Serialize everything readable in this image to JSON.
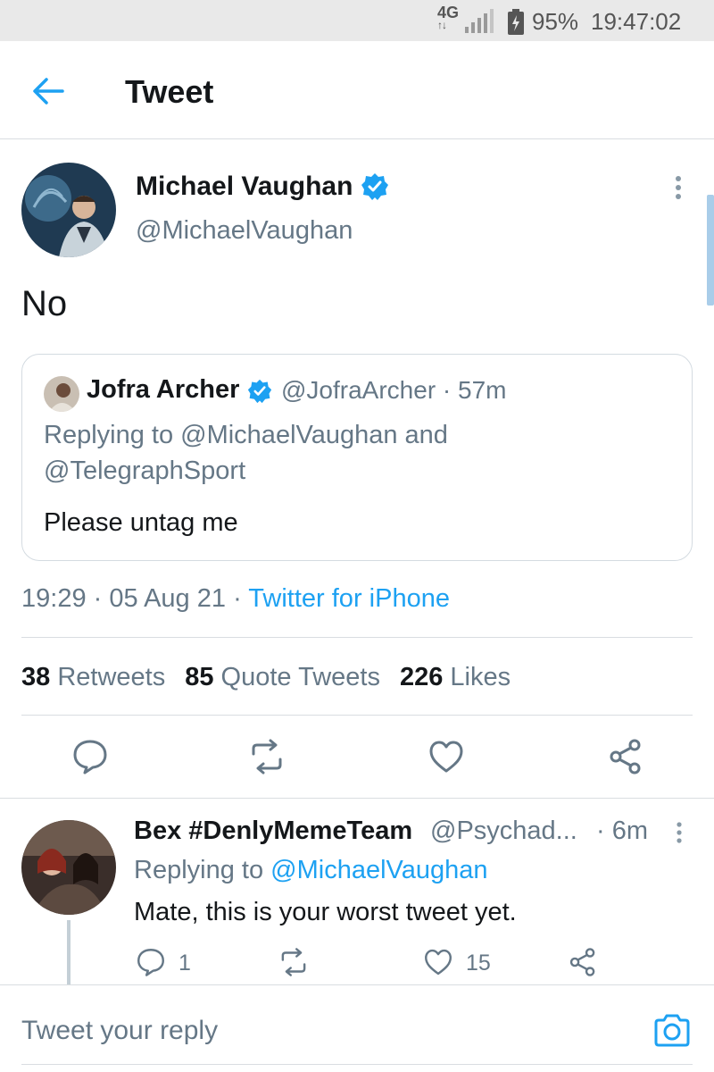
{
  "status_bar": {
    "network": "4G",
    "battery": "95%",
    "time": "19:47:02"
  },
  "header": {
    "title": "Tweet",
    "back_icon": "arrow-left-icon"
  },
  "tweet": {
    "author_name": "Michael Vaughan",
    "author_handle": "@MichaelVaughan",
    "verified": true,
    "text": "No",
    "quoted": {
      "author_name": "Jofra Archer",
      "author_handle": "@JofraArcher",
      "separator": "·",
      "time": "57m",
      "replying_to_line1": "Replying to @MichaelVaughan and",
      "replying_to_line2": "@TelegraphSport",
      "text": "Please untag me"
    },
    "time": "19:29",
    "date": "05 Aug 21",
    "separator": "·",
    "source": "Twitter for iPhone",
    "stats": {
      "retweets_count": "38",
      "retweets_label": "Retweets",
      "quotes_count": "85",
      "quotes_label": "Quote Tweets",
      "likes_count": "226",
      "likes_label": "Likes"
    }
  },
  "reply": {
    "author_name": "Bex #DenlyMemeTeam",
    "author_handle": "@Psychad...",
    "time": "· 6m",
    "replying_prefix": "Replying to",
    "replying_to": "@MichaelVaughan",
    "text": "Mate, this is your worst tweet yet.",
    "reply_count": "1",
    "like_count": "15"
  },
  "composer": {
    "placeholder": "Tweet your reply"
  },
  "colors": {
    "accent": "#1da1f2",
    "muted_text": "#657786",
    "primary_text": "#14171a"
  }
}
